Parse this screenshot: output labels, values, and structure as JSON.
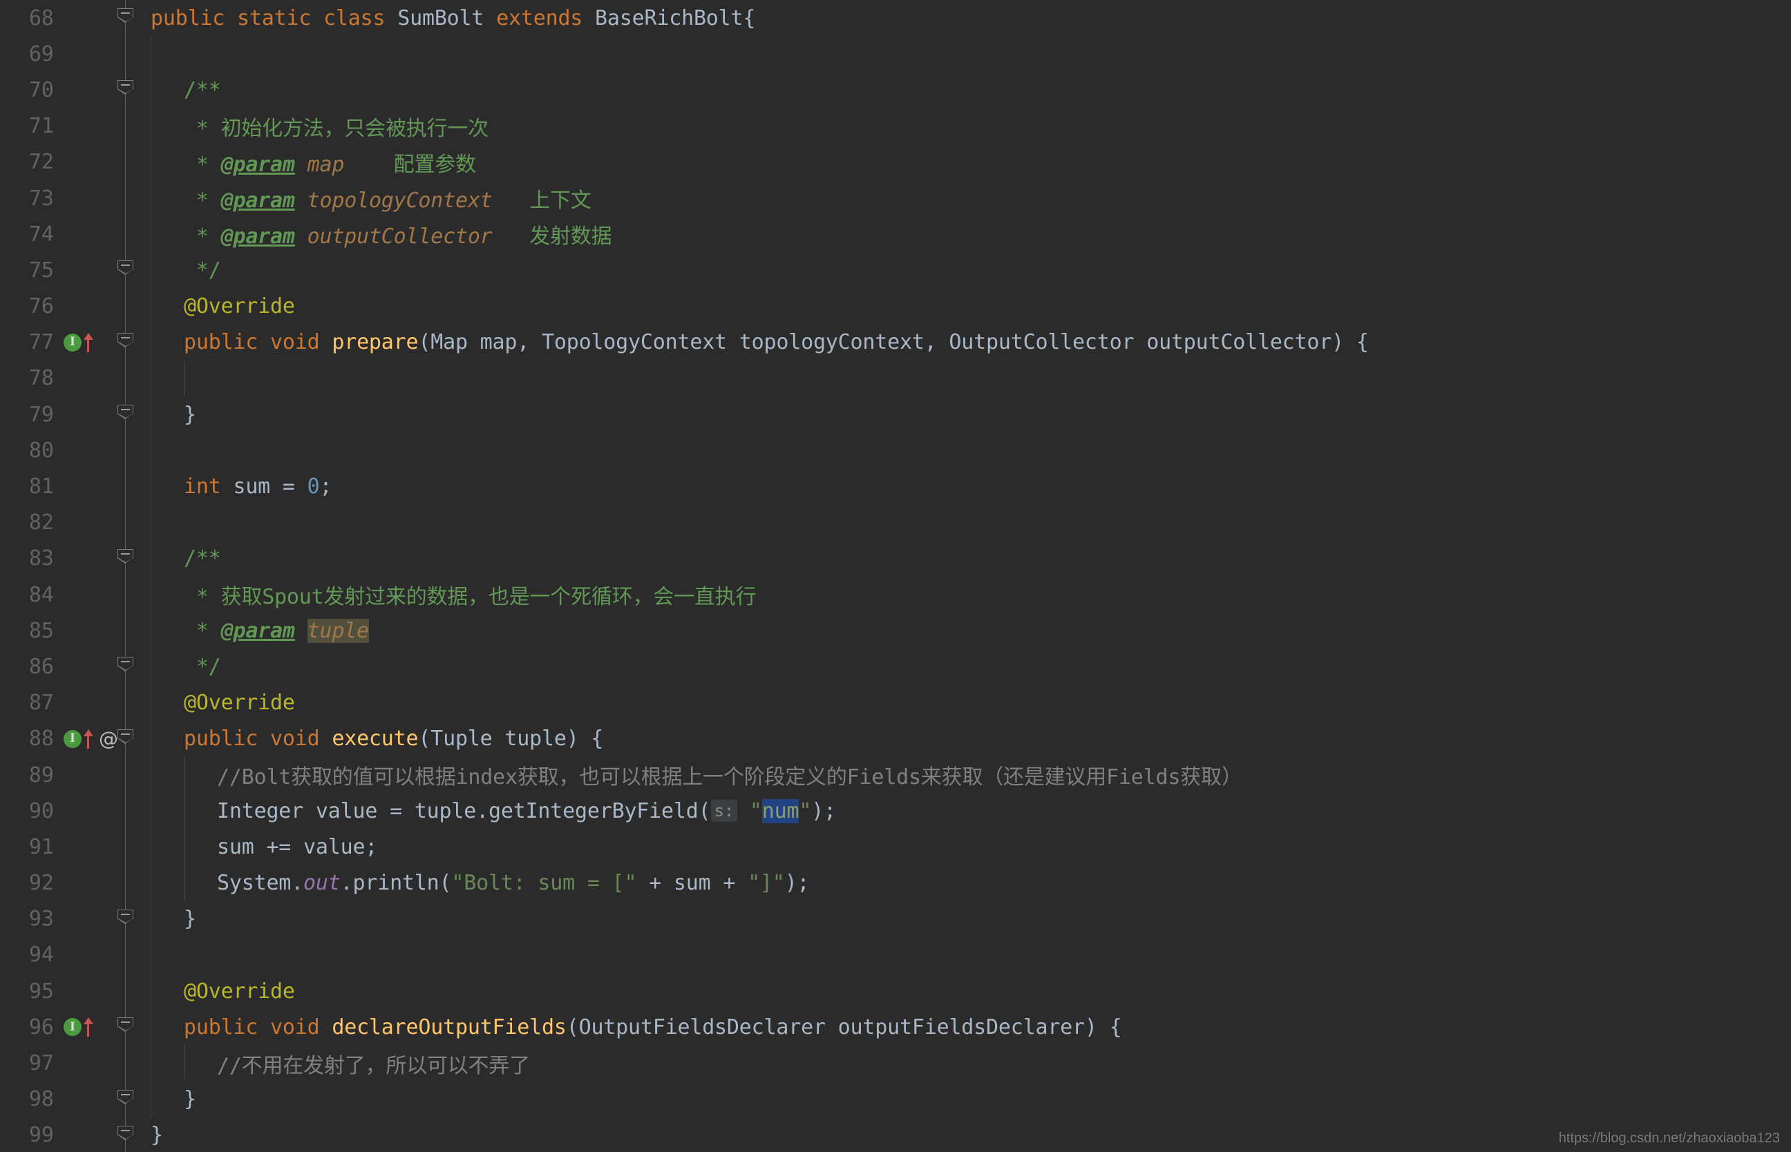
{
  "app": {
    "kind": "code-editor",
    "theme": "darcula",
    "background": "#2B2B2B",
    "default_text_color": "#A9B7C6",
    "watermark": "https://blog.csdn.net/zhaoxiaoba123"
  },
  "colors": {
    "keyword": "#CC7832",
    "method": "#FFC66D",
    "string": "#6A8759",
    "number": "#6897BB",
    "comment": "#808080",
    "javadoc": "#629755",
    "javadoc_param": "#A1774A",
    "annotation": "#BBB529",
    "static_field": "#9876AA",
    "identifier": "#A9B7C6",
    "selection": "#214283",
    "identifier_highlight": "#52503C",
    "gutter_number": "#606366",
    "implement_marker": "#4A9B3F",
    "override_arrow": "#C75450"
  },
  "gutter": {
    "first_line": 68,
    "last_line": 99
  },
  "lines": [
    {
      "num": "68",
      "fold": true,
      "markers": [],
      "indent": 0,
      "guides": [],
      "tokens": [
        {
          "t": "public ",
          "c": "kw"
        },
        {
          "t": "static ",
          "c": "kw"
        },
        {
          "t": "class ",
          "c": "kw"
        },
        {
          "t": "SumBolt ",
          "c": "cls"
        },
        {
          "t": "extends ",
          "c": "kw"
        },
        {
          "t": "BaseRichBolt",
          "c": "cls"
        },
        {
          "t": "{",
          "c": "ident"
        }
      ]
    },
    {
      "num": "69",
      "fold": false,
      "markers": [],
      "indent": 0,
      "guides": [
        "g1"
      ],
      "tokens": []
    },
    {
      "num": "70",
      "fold": true,
      "markers": [],
      "indent": 1,
      "guides": [
        "g1"
      ],
      "tokens": [
        {
          "t": "/**",
          "c": "doc"
        }
      ]
    },
    {
      "num": "71",
      "fold": false,
      "markers": [],
      "indent": 1,
      "guides": [
        "g1"
      ],
      "tokens": [
        {
          "t": " * 初始化方法，只会被执行一次",
          "c": "doc"
        }
      ]
    },
    {
      "num": "72",
      "fold": false,
      "markers": [],
      "indent": 1,
      "guides": [
        "g1"
      ],
      "tokens": [
        {
          "t": " * ",
          "c": "doc"
        },
        {
          "t": "@param",
          "c": "doctag"
        },
        {
          "t": " ",
          "c": "doc"
        },
        {
          "t": "map",
          "c": "docparam"
        },
        {
          "t": "    配置参数",
          "c": "doc"
        }
      ]
    },
    {
      "num": "73",
      "fold": false,
      "markers": [],
      "indent": 1,
      "guides": [
        "g1"
      ],
      "tokens": [
        {
          "t": " * ",
          "c": "doc"
        },
        {
          "t": "@param",
          "c": "doctag"
        },
        {
          "t": " ",
          "c": "doc"
        },
        {
          "t": "topologyContext",
          "c": "docparam"
        },
        {
          "t": "   上下文",
          "c": "doc"
        }
      ]
    },
    {
      "num": "74",
      "fold": false,
      "markers": [],
      "indent": 1,
      "guides": [
        "g1"
      ],
      "tokens": [
        {
          "t": " * ",
          "c": "doc"
        },
        {
          "t": "@param",
          "c": "doctag"
        },
        {
          "t": " ",
          "c": "doc"
        },
        {
          "t": "outputCollector",
          "c": "docparam"
        },
        {
          "t": "   发射数据",
          "c": "doc"
        }
      ]
    },
    {
      "num": "75",
      "fold": true,
      "markers": [],
      "indent": 1,
      "guides": [
        "g1"
      ],
      "tokens": [
        {
          "t": " */",
          "c": "doc"
        }
      ]
    },
    {
      "num": "76",
      "fold": false,
      "markers": [],
      "indent": 1,
      "guides": [
        "g1"
      ],
      "tokens": [
        {
          "t": "@Override",
          "c": "anno"
        }
      ]
    },
    {
      "num": "77",
      "fold": true,
      "markers": [
        "impl",
        "arrow"
      ],
      "indent": 1,
      "guides": [
        "g1"
      ],
      "tokens": [
        {
          "t": "public ",
          "c": "kw"
        },
        {
          "t": "void ",
          "c": "kw"
        },
        {
          "t": "prepare",
          "c": "mth"
        },
        {
          "t": "(Map map, TopologyContext topologyContext, OutputCollector outputCollector) {",
          "c": "ident"
        }
      ]
    },
    {
      "num": "78",
      "fold": false,
      "markers": [],
      "indent": 1,
      "guides": [
        "g1",
        "g2"
      ],
      "tokens": []
    },
    {
      "num": "79",
      "fold": true,
      "markers": [],
      "indent": 1,
      "guides": [
        "g1"
      ],
      "tokens": [
        {
          "t": "}",
          "c": "ident"
        }
      ]
    },
    {
      "num": "80",
      "fold": false,
      "markers": [],
      "indent": 1,
      "guides": [
        "g1"
      ],
      "tokens": []
    },
    {
      "num": "81",
      "fold": false,
      "markers": [],
      "indent": 1,
      "guides": [
        "g1"
      ],
      "tokens": [
        {
          "t": "int ",
          "c": "kw"
        },
        {
          "t": "sum ",
          "c": "ident"
        },
        {
          "t": "= ",
          "c": "ident"
        },
        {
          "t": "0",
          "c": "num"
        },
        {
          "t": ";",
          "c": "ident"
        }
      ]
    },
    {
      "num": "82",
      "fold": false,
      "markers": [],
      "indent": 1,
      "guides": [
        "g1"
      ],
      "tokens": []
    },
    {
      "num": "83",
      "fold": true,
      "markers": [],
      "indent": 1,
      "guides": [
        "g1"
      ],
      "tokens": [
        {
          "t": "/**",
          "c": "doc"
        }
      ]
    },
    {
      "num": "84",
      "fold": false,
      "markers": [],
      "indent": 1,
      "guides": [
        "g1"
      ],
      "tokens": [
        {
          "t": " * 获取",
          "c": "doc"
        },
        {
          "t": "Spout",
          "c": "doc"
        },
        {
          "t": "发射过来的数据，也是一个死循环，会一直执行",
          "c": "doc"
        }
      ]
    },
    {
      "num": "85",
      "fold": false,
      "markers": [],
      "indent": 1,
      "guides": [
        "g1"
      ],
      "tokens": [
        {
          "t": " * ",
          "c": "doc"
        },
        {
          "t": "@param",
          "c": "doctag"
        },
        {
          "t": " ",
          "c": "doc"
        },
        {
          "t": "tuple",
          "c": "hl-ident"
        }
      ]
    },
    {
      "num": "86",
      "fold": true,
      "markers": [],
      "indent": 1,
      "guides": [
        "g1"
      ],
      "tokens": [
        {
          "t": " */",
          "c": "doc"
        }
      ]
    },
    {
      "num": "87",
      "fold": false,
      "markers": [],
      "indent": 1,
      "guides": [
        "g1"
      ],
      "tokens": [
        {
          "t": "@Override",
          "c": "anno"
        }
      ]
    },
    {
      "num": "88",
      "fold": true,
      "markers": [
        "impl",
        "arrow",
        "at"
      ],
      "indent": 1,
      "guides": [
        "g1"
      ],
      "tokens": [
        {
          "t": "public ",
          "c": "kw"
        },
        {
          "t": "void ",
          "c": "kw"
        },
        {
          "t": "execute",
          "c": "mth"
        },
        {
          "t": "(Tuple tuple) {",
          "c": "ident"
        }
      ]
    },
    {
      "num": "89",
      "fold": false,
      "markers": [],
      "indent": 2,
      "guides": [
        "g1",
        "g2"
      ],
      "tokens": [
        {
          "t": "//Bolt获取的值可以根据index获取，也可以根据上一个阶段定义的Fields来获取（还是建议用Fields获取）",
          "c": "cmt"
        }
      ]
    },
    {
      "num": "90",
      "fold": false,
      "markers": [],
      "indent": 2,
      "guides": [
        "g1",
        "g2"
      ],
      "tokens": [
        {
          "t": "Integer ",
          "c": "ident"
        },
        {
          "t": "value = tuple.",
          "c": "ident"
        },
        {
          "t": "getIntegerByField",
          "c": "ident"
        },
        {
          "t": "(",
          "c": "ident"
        },
        {
          "t": "s:",
          "c": "hint"
        },
        {
          "t": " ",
          "c": "ident"
        },
        {
          "t": "\"",
          "c": "str"
        },
        {
          "t": "num",
          "c": "sel"
        },
        {
          "t": "\"",
          "c": "str"
        },
        {
          "t": ");",
          "c": "ident"
        }
      ]
    },
    {
      "num": "91",
      "fold": false,
      "markers": [],
      "indent": 2,
      "guides": [
        "g1",
        "g2"
      ],
      "tokens": [
        {
          "t": "sum += value;",
          "c": "ident"
        }
      ]
    },
    {
      "num": "92",
      "fold": false,
      "markers": [],
      "indent": 2,
      "guides": [
        "g1",
        "g2"
      ],
      "tokens": [
        {
          "t": "System.",
          "c": "ident"
        },
        {
          "t": "out",
          "c": "statfld"
        },
        {
          "t": ".println(",
          "c": "ident"
        },
        {
          "t": "\"Bolt: sum = [\"",
          "c": "str"
        },
        {
          "t": " + sum + ",
          "c": "ident"
        },
        {
          "t": "\"]\"",
          "c": "str"
        },
        {
          "t": ");",
          "c": "ident"
        }
      ]
    },
    {
      "num": "93",
      "fold": true,
      "markers": [],
      "indent": 1,
      "guides": [
        "g1"
      ],
      "tokens": [
        {
          "t": "}",
          "c": "ident"
        }
      ]
    },
    {
      "num": "94",
      "fold": false,
      "markers": [],
      "indent": 1,
      "guides": [
        "g1"
      ],
      "tokens": []
    },
    {
      "num": "95",
      "fold": false,
      "markers": [],
      "indent": 1,
      "guides": [
        "g1"
      ],
      "tokens": [
        {
          "t": "@Override",
          "c": "anno"
        }
      ]
    },
    {
      "num": "96",
      "fold": true,
      "markers": [
        "impl",
        "arrow"
      ],
      "indent": 1,
      "guides": [
        "g1"
      ],
      "tokens": [
        {
          "t": "public ",
          "c": "kw"
        },
        {
          "t": "void ",
          "c": "kw"
        },
        {
          "t": "declareOutputFields",
          "c": "mth"
        },
        {
          "t": "(OutputFieldsDeclarer outputFieldsDeclarer) {",
          "c": "ident"
        }
      ]
    },
    {
      "num": "97",
      "fold": false,
      "markers": [],
      "indent": 2,
      "guides": [
        "g1",
        "g2"
      ],
      "tokens": [
        {
          "t": "//不用在发射了，所以可以不弄了",
          "c": "cmt"
        }
      ]
    },
    {
      "num": "98",
      "fold": true,
      "markers": [],
      "indent": 1,
      "guides": [
        "g1"
      ],
      "tokens": [
        {
          "t": "}",
          "c": "ident"
        }
      ]
    },
    {
      "num": "99",
      "fold": true,
      "markers": [],
      "indent": 0,
      "guides": [],
      "tokens": [
        {
          "t": "}",
          "c": "ident"
        }
      ]
    }
  ]
}
